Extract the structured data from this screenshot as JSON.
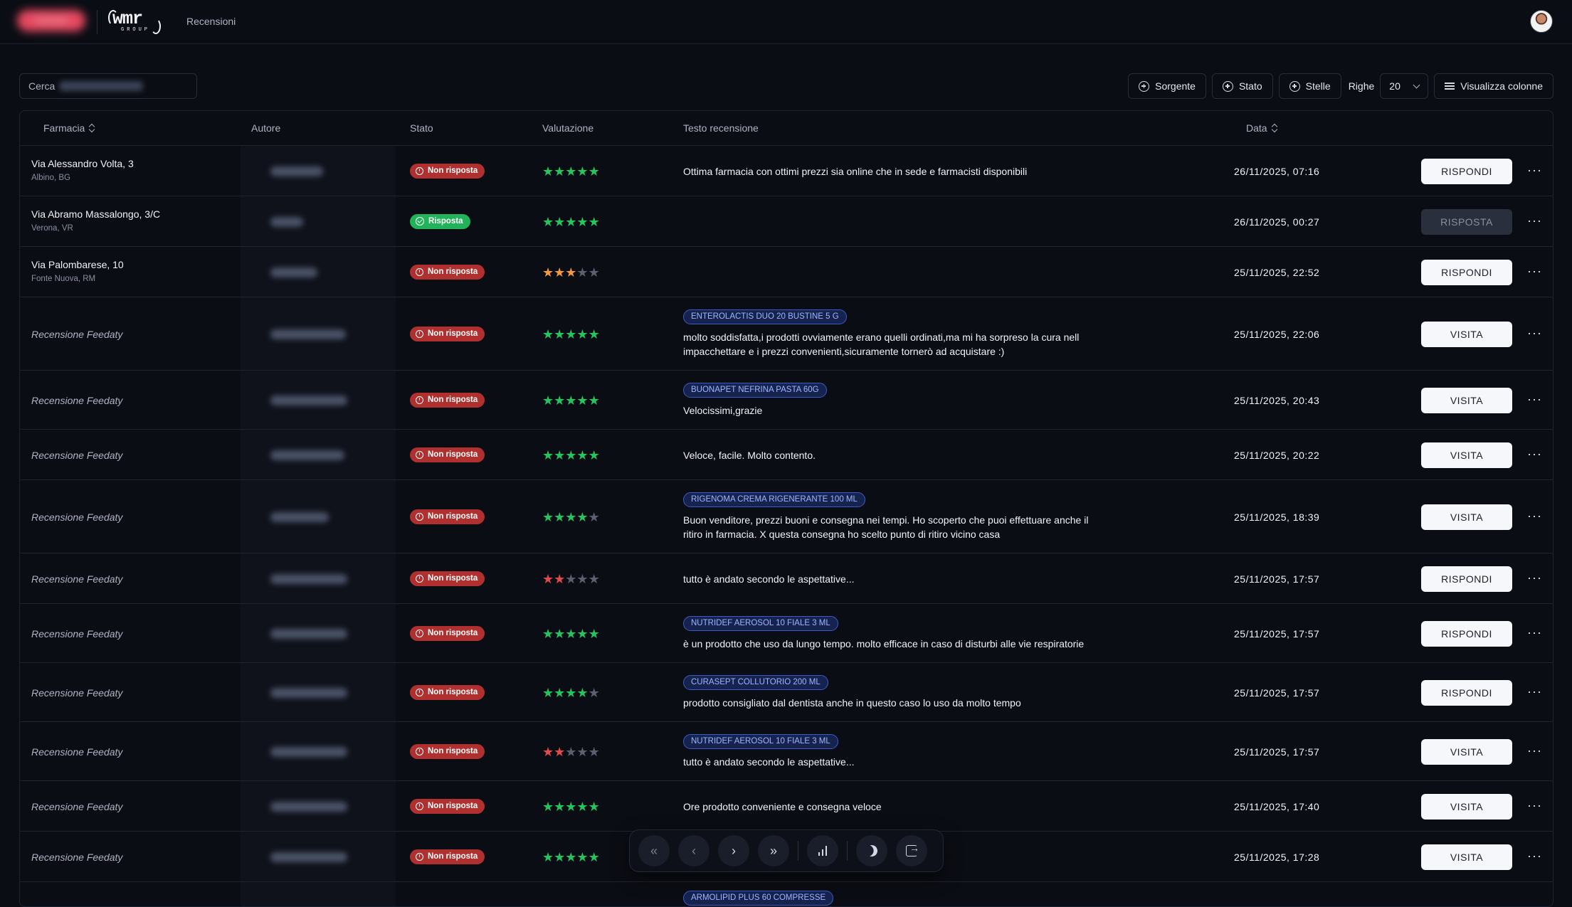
{
  "header": {
    "brand_text": "Farmacia",
    "logo_text": "wmr",
    "logo_sub": "GROUP",
    "nav_link": "Recensioni"
  },
  "toolbar": {
    "search_label": "Cerca",
    "filter_source": "Sorgente",
    "filter_status": "Stato",
    "filter_stars": "Stelle",
    "rows_label": "Righe",
    "rows_value": "20",
    "columns_button": "Visualizza colonne"
  },
  "table": {
    "headers": {
      "pharmacy": "Farmacia",
      "author": "Autore",
      "status": "Stato",
      "rating": "Valutazione",
      "text": "Testo recensione",
      "date": "Data"
    },
    "rows": [
      {
        "pharmacy": "Via Alessandro Volta, 3",
        "city": "Albino, BG",
        "status": "Non risposta",
        "answered": false,
        "rating": 5,
        "star_color": "#22c55e",
        "tag": "",
        "text": "Ottima farmacia con ottimi prezzi sia online che in sede e farmacisti disponibili",
        "date": "26/11/2025, 07:16",
        "action": "RISPONDI"
      },
      {
        "pharmacy": "Via Abramo Massalongo, 3/C",
        "city": "Verona, VR",
        "status": "Risposta",
        "answered": true,
        "rating": 5,
        "star_color": "#22c55e",
        "tag": "",
        "text": "",
        "date": "26/11/2025, 00:27",
        "action": "RISPOSTA"
      },
      {
        "pharmacy": "Via Palombarese, 10",
        "city": "Fonte Nuova, RM",
        "status": "Non risposta",
        "answered": false,
        "rating": 3,
        "star_color": "#f29a3a",
        "tag": "",
        "text": "",
        "date": "25/11/2025, 22:52",
        "action": "RISPONDI"
      },
      {
        "pharmacy": "Recensione Feedaty",
        "city": "",
        "status": "Non risposta",
        "answered": false,
        "rating": 5,
        "star_color": "#22c55e",
        "tag": "ENTEROLACTIS DUO 20 BUSTINE 5 G",
        "text": "molto soddisfatta,i prodotti ovviamente erano quelli ordinati,ma mi ha sorpreso la cura nell impacchettare e  i prezzi convenienti,sicuramente tornerò ad acquistare  :)",
        "date": "25/11/2025, 22:06",
        "action": "VISITA"
      },
      {
        "pharmacy": "Recensione Feedaty",
        "city": "",
        "status": "Non risposta",
        "answered": false,
        "rating": 5,
        "star_color": "#22c55e",
        "tag": "BUONAPET NEFRINA PASTA 60G",
        "text": "Velocissimi,grazie",
        "date": "25/11/2025, 20:43",
        "action": "VISITA"
      },
      {
        "pharmacy": "Recensione Feedaty",
        "city": "",
        "status": "Non risposta",
        "answered": false,
        "rating": 5,
        "star_color": "#22c55e",
        "tag": "",
        "text": "Veloce,  facile.  Molto contento.",
        "date": "25/11/2025, 20:22",
        "action": "VISITA"
      },
      {
        "pharmacy": "Recensione Feedaty",
        "city": "",
        "status": "Non risposta",
        "answered": false,
        "rating": 4,
        "star_color": "#22c55e",
        "tag": "RIGENOMA CREMA RIGENERANTE 100 ML",
        "text": "Buon venditore, prezzi buoni e consegna nei tempi. Ho scoperto che puoi effettuare anche il ritiro in farmacia. X questa consegna ho scelto punto di ritiro vicino casa",
        "date": "25/11/2025, 18:39",
        "action": "VISITA"
      },
      {
        "pharmacy": "Recensione Feedaty",
        "city": "",
        "status": "Non risposta",
        "answered": false,
        "rating": 2,
        "star_color": "#e5484d",
        "tag": "",
        "text": "tutto è andato secondo le aspettative...",
        "date": "25/11/2025, 17:57",
        "action": "RISPONDI"
      },
      {
        "pharmacy": "Recensione Feedaty",
        "city": "",
        "status": "Non risposta",
        "answered": false,
        "rating": 5,
        "star_color": "#22c55e",
        "tag": "NUTRIDEF AEROSOL 10 FIALE 3 ML",
        "text": "è un prodotto che uso da lungo tempo. molto efficace in caso di disturbi alle vie respiratorie",
        "date": "25/11/2025, 17:57",
        "action": "RISPONDI"
      },
      {
        "pharmacy": "Recensione Feedaty",
        "city": "",
        "status": "Non risposta",
        "answered": false,
        "rating": 4,
        "star_color": "#22c55e",
        "tag": "CURASEPT COLLUTORIO 200 ML",
        "text": "prodotto consigliato dal dentista anche in questo caso lo uso da molto tempo",
        "date": "25/11/2025, 17:57",
        "action": "RISPONDI"
      },
      {
        "pharmacy": "Recensione Feedaty",
        "city": "",
        "status": "Non risposta",
        "answered": false,
        "rating": 2,
        "star_color": "#e5484d",
        "tag": "NUTRIDEF AEROSOL 10 FIALE 3 ML",
        "text": "tutto è andato secondo le aspettative...",
        "date": "25/11/2025, 17:57",
        "action": "VISITA"
      },
      {
        "pharmacy": "Recensione Feedaty",
        "city": "",
        "status": "Non risposta",
        "answered": false,
        "rating": 5,
        "star_color": "#22c55e",
        "tag": "",
        "text": "Ore prodotto conveniente e consegna veloce",
        "date": "25/11/2025, 17:40",
        "action": "VISITA"
      },
      {
        "pharmacy": "Recensione Feedaty",
        "city": "",
        "status": "Non risposta",
        "answered": false,
        "rating": 5,
        "star_color": "#22c55e",
        "tag": "",
        "text": "o.",
        "date": "25/11/2025, 17:28",
        "action": "VISITA"
      },
      {
        "pharmacy": "",
        "city": "",
        "status": "",
        "answered": false,
        "rating": 0,
        "star_color": "#22c55e",
        "tag": "ARMOLIPID PLUS 60 COMPRESSE",
        "text": "",
        "date": "",
        "action": ""
      }
    ]
  },
  "dock": {
    "icons": [
      "first-page-icon",
      "prev-page-icon",
      "next-page-icon",
      "last-page-icon",
      "stats-icon",
      "theme-icon",
      "logout-icon"
    ]
  }
}
